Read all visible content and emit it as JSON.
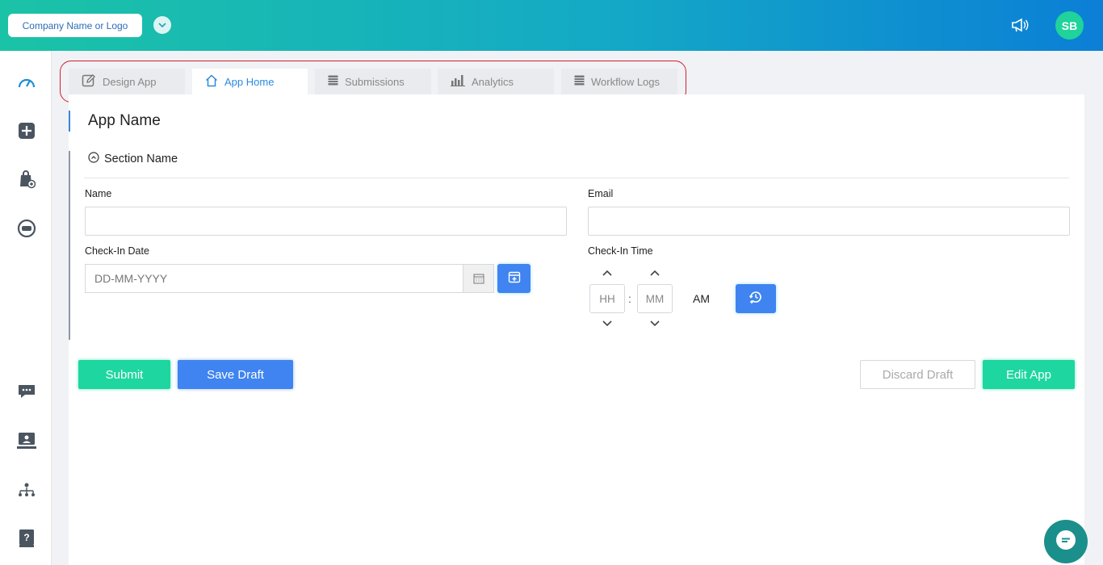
{
  "header": {
    "company_label": "Company Name or Logo",
    "avatar_initials": "SB"
  },
  "tabs": [
    {
      "label": "Design App",
      "icon": "edit-icon",
      "active": false
    },
    {
      "label": "App Home",
      "icon": "home-icon",
      "active": true
    },
    {
      "label": "Submissions",
      "icon": "list-icon",
      "active": false
    },
    {
      "label": "Analytics",
      "icon": "bar-chart-icon",
      "active": false
    },
    {
      "label": "Workflow Logs",
      "icon": "list-icon",
      "active": false
    }
  ],
  "sidebar": {
    "icons": [
      "dashboard-icon",
      "add-icon",
      "bag-add-icon",
      "apps-icon",
      "chat-icon",
      "monitor-user-icon",
      "org-chart-icon",
      "help-book-icon"
    ]
  },
  "form": {
    "app_name": "App Name",
    "section_name": "Section Name",
    "name_label": "Name",
    "email_label": "Email",
    "checkin_date_label": "Check-In Date",
    "checkin_date_placeholder": "DD-MM-YYYY",
    "checkin_time_label": "Check-In Time",
    "hour_placeholder": "HH",
    "minute_placeholder": "MM",
    "time_separator": ":",
    "ampm": "AM"
  },
  "actions": {
    "submit": "Submit",
    "save_draft": "Save Draft",
    "discard_draft": "Discard Draft",
    "edit_app": "Edit App"
  },
  "colors": {
    "primary_blue": "#3f84f0",
    "accent_green": "#1ed6a0",
    "highlight_red": "#d0202e"
  }
}
